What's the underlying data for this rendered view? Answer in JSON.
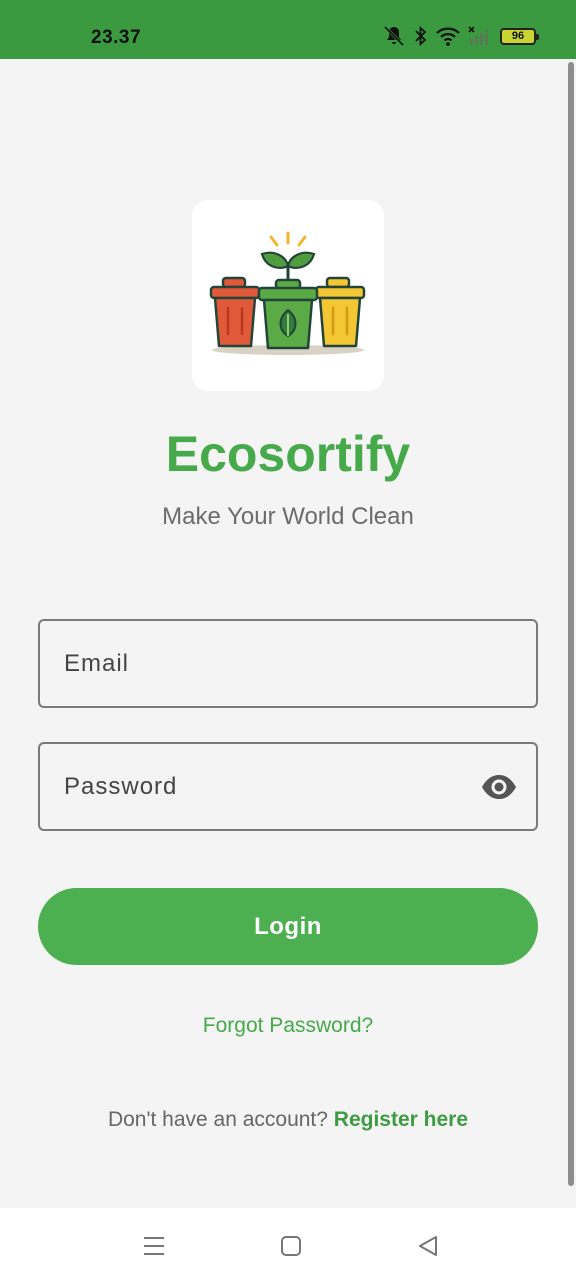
{
  "status_bar": {
    "time": "23.37",
    "battery": "96"
  },
  "logo": {
    "icon": "recycling-bins-sprout-icon",
    "bin_colors": [
      "#e05a3a",
      "#5aab45",
      "#f2c733"
    ]
  },
  "app": {
    "title": "Ecosortify",
    "tagline": "Make Your World Clean"
  },
  "form": {
    "email_placeholder": "Email",
    "password_placeholder": "Password",
    "password_toggle_icon": "eye-icon",
    "login_label": "Login",
    "forgot_label": "Forgot Password?",
    "register_prompt": "Don't have an account?",
    "register_link": "Register here"
  },
  "colors": {
    "status_bar": "#3b9a3f",
    "brand_green": "#4caf50",
    "background": "#f4f4f4"
  },
  "nav_bar": {
    "icons": [
      "menu-icon",
      "home-square-icon",
      "back-triangle-icon"
    ]
  }
}
